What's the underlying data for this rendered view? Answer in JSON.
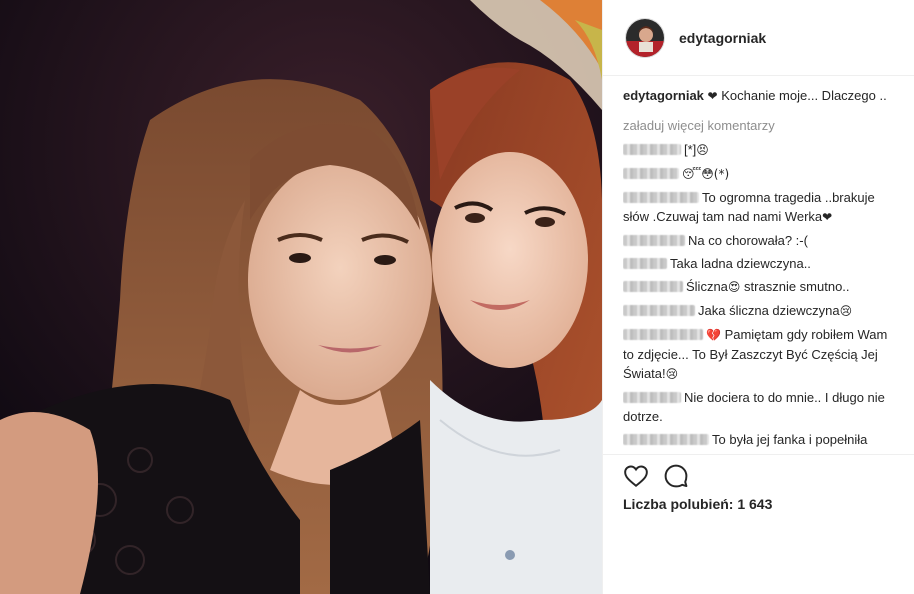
{
  "post": {
    "username": "edytagorniak",
    "caption_text": "Kochanie moje... Dlaczego ..",
    "caption_heart": "❤",
    "load_more": "załaduj więcej komentarzy",
    "likes_text": "Liczba polubień: 1 643"
  },
  "comments": [
    {
      "name_width": 58,
      "text": "[*]",
      "emoji": "😣"
    },
    {
      "name_width": 56,
      "text": "",
      "emoji": "😴😳(*)"
    },
    {
      "name_width": 76,
      "text": "To ogromna tragedia ..brakuje słów .Czuwaj tam nad nami Werka",
      "emoji": "❤"
    },
    {
      "name_width": 62,
      "text": "Na co chorowała? :-(",
      "emoji": ""
    },
    {
      "name_width": 44,
      "text": "Taka ladna dziewczyna..",
      "emoji": ""
    },
    {
      "name_width": 60,
      "text": "Śliczna",
      "emoji": "😍",
      "text2": " strasznie smutno.."
    },
    {
      "name_width": 72,
      "text": "Jaka śliczna dziewczyna",
      "emoji": "😢"
    },
    {
      "name_width": 80,
      "text": "",
      "emoji": "💔",
      "text2": " Pamiętam gdy robiłem Wam to zdjęcie... To Był Zaszczyt Być Częścią Jej Świata!",
      "emoji2": "😢"
    },
    {
      "name_width": 58,
      "text": "Nie dociera to do mnie.. I długo nie dotrze.",
      "emoji": ""
    },
    {
      "name_width": 86,
      "text": "To była jej fanka i popełniła",
      "emoji": ""
    }
  ],
  "icons": [
    "heart-icon",
    "comment-icon"
  ],
  "colors": {
    "text": "#262626",
    "muted": "#8e8e8e",
    "divider": "#efefef"
  }
}
